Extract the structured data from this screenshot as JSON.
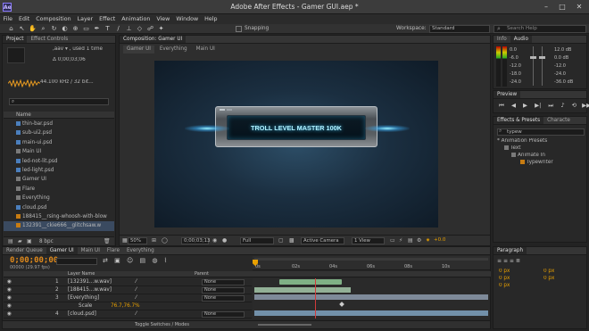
{
  "app": {
    "logo_text": "Ae",
    "title": "Adobe After Effects - Gamer GUI.aep *"
  },
  "window_controls": [
    "–",
    "□",
    "✕"
  ],
  "menu": [
    "File",
    "Edit",
    "Composition",
    "Layer",
    "Effect",
    "Animation",
    "View",
    "Window",
    "Help"
  ],
  "toolbar": {
    "snapping_label": "Snapping",
    "workspace_label": "Workspace:",
    "workspace_value": "Standard",
    "search_placeholder": "Search Help"
  },
  "project_panel": {
    "tabs": [
      "Project",
      "Effect Controls"
    ],
    "selected_name": ",aav ▾ , used 1 time",
    "duration": "Δ 0;00;03;06",
    "audio_info": "44.100 kHz / 32 bit...",
    "search_placeholder": "⌕",
    "column_header": "Name",
    "items": [
      {
        "name": "thin-bar.psd",
        "type": "img"
      },
      {
        "name": "sub-ui2.psd",
        "type": "img"
      },
      {
        "name": "main-ui.psd",
        "type": "img"
      },
      {
        "name": "Main UI",
        "type": "comp"
      },
      {
        "name": "led-not-lit.psd",
        "type": "img"
      },
      {
        "name": "led-light.psd",
        "type": "img"
      },
      {
        "name": "Gamer UI",
        "type": "comp"
      },
      {
        "name": "Flare",
        "type": "comp"
      },
      {
        "name": "Everything",
        "type": "comp"
      },
      {
        "name": "cloud.psd",
        "type": "img"
      },
      {
        "name": "188415__rsing-whoosh-with-blow",
        "type": "audio"
      },
      {
        "name": "132391__ckie666__glitchsaw.w",
        "type": "audio"
      }
    ],
    "bpc": "8 bpc"
  },
  "comp_panel": {
    "tab": "Composition: Gamer UI",
    "breadcrumbs": [
      "Gamer UI",
      "Everything",
      "Main UI"
    ],
    "banner_text": "TROLL LEVEL MASTER 100K",
    "zoom": "50%",
    "timecode": "0;00;03;13",
    "resolution": "Full",
    "camera": "Active Camera",
    "view": "1 View",
    "exposure": "+0.0"
  },
  "audio_panel": {
    "tabs": [
      "Info",
      "Audio"
    ],
    "left_labels": [
      "0.0",
      "-6.0",
      "-12.0",
      "-18.0",
      "-24.0"
    ],
    "right_labels": [
      "12.0 dB",
      "0.0 dB",
      "-12.0",
      "-24.0",
      "-36.0 dB"
    ]
  },
  "preview_panel": {
    "tab": "Preview"
  },
  "effects_panel": {
    "tabs": [
      "Effects & Presets",
      "Characte"
    ],
    "search_value": "typew",
    "tree": [
      {
        "label": "* Animation Presets",
        "level": 0
      },
      {
        "label": "Text",
        "level": 1
      },
      {
        "label": "Animate In",
        "level": 2
      },
      {
        "label": "Typewriter",
        "level": 3
      }
    ]
  },
  "paragraph_panel": {
    "tab": "Paragraph",
    "fields": [
      "0 px",
      "0 px",
      "0 px",
      "0 px",
      "0 px"
    ]
  },
  "timeline": {
    "tabs": [
      "Render Queue",
      "Gamer UI",
      "Main UI",
      "Flare",
      "Everything"
    ],
    "timecode": "0;00;00;00",
    "fps": "00000 (29.97 fps)",
    "ruler_ticks": [
      "0s",
      "02s",
      "04s",
      "06s",
      "08s",
      "10s"
    ],
    "layer_header": "Layer Name",
    "parent_header": "Parent",
    "layers": [
      {
        "num": "1",
        "name": "[132391...w.wav]",
        "parent": "None"
      },
      {
        "num": "2",
        "name": "[188415...w.wav]",
        "parent": "None"
      },
      {
        "num": "3",
        "name": "[Everything]",
        "parent": "None"
      },
      {
        "num": "",
        "name": "Scale",
        "value": "76.7,76.7%",
        "parent": ""
      },
      {
        "num": "4",
        "name": "[cloud.psd]",
        "parent": "None"
      }
    ],
    "footer": "Toggle Switches / Modes"
  },
  "colors": {
    "accent_orange": "#e8a000",
    "timecode_orange": "#e08a1c",
    "comp_glow": "#3fc8ff",
    "banner_text": "#aef0ff"
  }
}
